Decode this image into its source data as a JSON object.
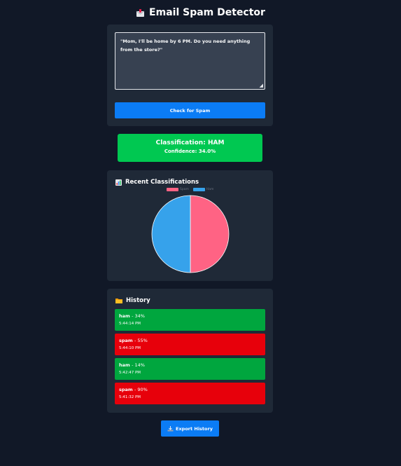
{
  "header": {
    "title": "Email Spam Detector",
    "icon": "mail-inbox-icon"
  },
  "input": {
    "message": "\"Mom, I'll be home by 6 PM. Do you need anything from the store?\"",
    "check_label": "Check for Spam"
  },
  "result": {
    "classification": "Classification: HAM",
    "confidence": "Confidence: 34.0%",
    "color": "#00c851"
  },
  "chart": {
    "title": "Recent Classifications",
    "icon": "bar-chart-icon"
  },
  "chart_data": {
    "type": "pie",
    "categories": [
      "Spam",
      "Ham"
    ],
    "values": [
      2,
      2
    ],
    "colors": [
      "#ff6384",
      "#36a2eb"
    ],
    "legend": "top"
  },
  "history": {
    "title": "History",
    "icon": "folder-icon",
    "items": [
      {
        "label": "ham",
        "percent": "- 34%",
        "time": "5:44:14 PM",
        "color": "#00a63e"
      },
      {
        "label": "spam",
        "percent": "- 55%",
        "time": "5:44:10 PM",
        "color": "#e7000b"
      },
      {
        "label": "ham",
        "percent": "- 14%",
        "time": "5:42:47 PM",
        "color": "#00a63e"
      },
      {
        "label": "spam",
        "percent": "- 90%",
        "time": "5:41:32 PM",
        "color": "#e7000b"
      }
    ]
  },
  "export": {
    "label": "Export History",
    "icon": "export-tray-icon"
  }
}
